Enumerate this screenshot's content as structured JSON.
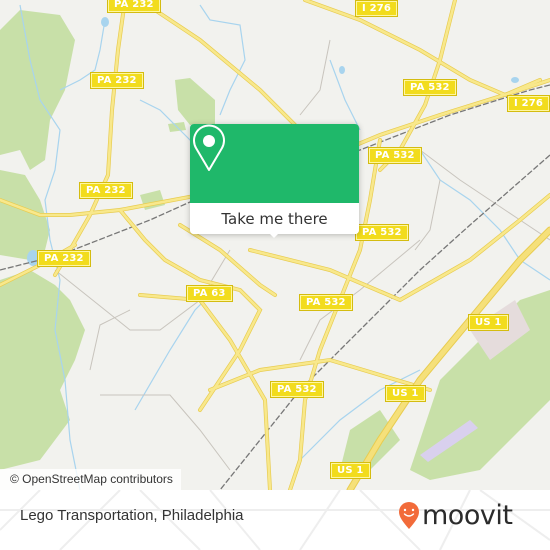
{
  "map": {
    "road_labels": [
      {
        "id": "pa232-top",
        "text": "PA 232"
      },
      {
        "id": "pa232-upper",
        "text": "PA 232"
      },
      {
        "id": "pa232-mid",
        "text": "PA 232"
      },
      {
        "id": "pa232-lower",
        "text": "PA 232"
      },
      {
        "id": "i276-top",
        "text": "I 276"
      },
      {
        "id": "i276-right",
        "text": "I 276"
      },
      {
        "id": "pa532-upper",
        "text": "PA 532"
      },
      {
        "id": "pa532-rail",
        "text": "PA 532"
      },
      {
        "id": "pa532-near-popup",
        "text": "PA 532"
      },
      {
        "id": "pa532-center",
        "text": "PA 532"
      },
      {
        "id": "pa532-lower",
        "text": "PA 532"
      },
      {
        "id": "pa63",
        "text": "PA 63"
      },
      {
        "id": "us1-right",
        "text": "US 1"
      },
      {
        "id": "us1-mid",
        "text": "US 1"
      },
      {
        "id": "us1-bottom",
        "text": "US 1"
      }
    ],
    "colors": {
      "background": "#f2f2ee",
      "park": "#c8e0a8",
      "water": "#a8d4ee",
      "road": "#f5e07a",
      "shield": "#f2dc1d"
    }
  },
  "popup": {
    "icon": "map-pin-icon",
    "button_label": "Take me there",
    "color": "#1fb86a"
  },
  "attribution": "© OpenStreetMap contributors",
  "footer": {
    "place_name": "Lego Transportation, Philadelphia",
    "brand": "moovit",
    "brand_color": "#f26b3a"
  }
}
